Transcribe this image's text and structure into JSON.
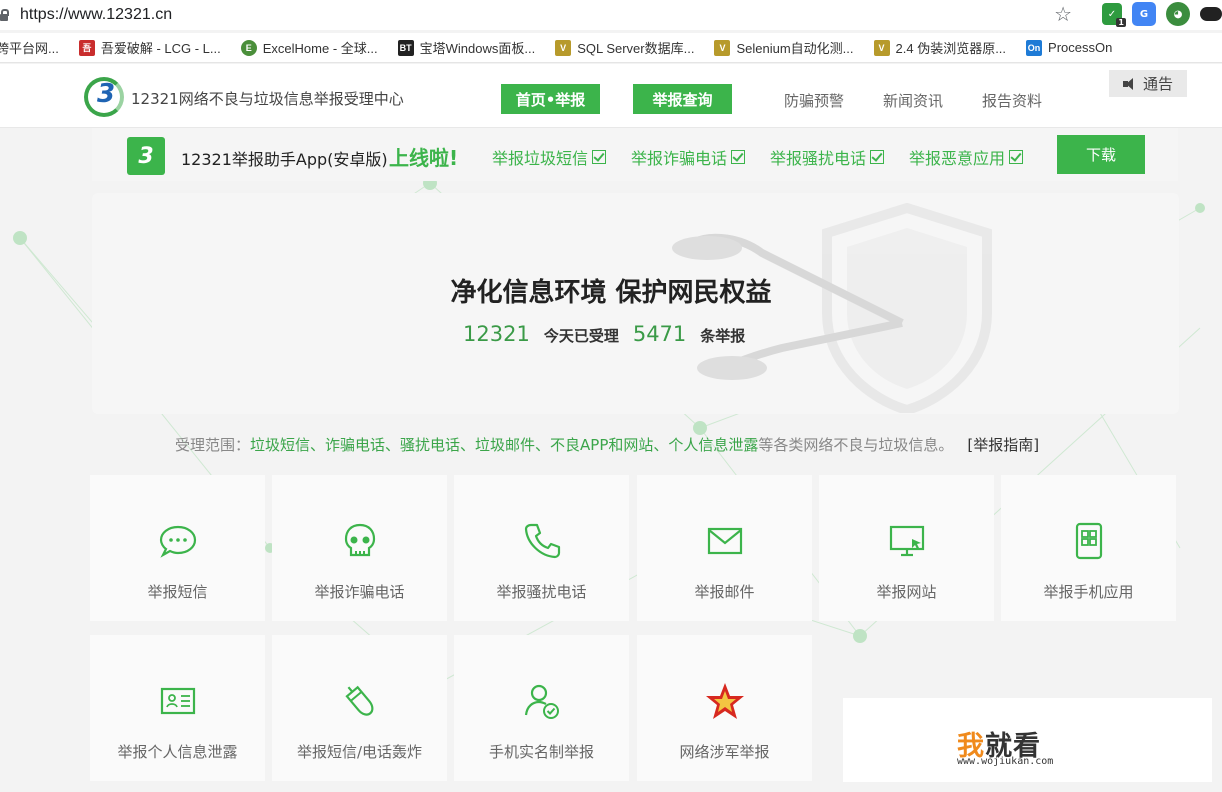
{
  "browser": {
    "url": "https://www.12321.cn",
    "bookmarks": [
      {
        "label": "跨平台网...",
        "icon_color": "#ffffff"
      },
      {
        "label": "吾爱破解 - LCG - L...",
        "icon_color": "#c92d2d"
      },
      {
        "label": "ExcelHome - 全球...",
        "icon_color": "#4b8f3b"
      },
      {
        "label": "宝塔Windows面板...",
        "icon_color": "#222222"
      },
      {
        "label": "SQL Server数据库...",
        "icon_color": "#b79a2b"
      },
      {
        "label": "Selenium自动化测...",
        "icon_color": "#b79a2b"
      },
      {
        "label": "2.4 伪装浏览器原...",
        "icon_color": "#b79a2b"
      },
      {
        "label": "ProcessOn",
        "icon_color": "#1e7bd6"
      }
    ],
    "ext_badge": "1",
    "bm_bt": "BT",
    "bm_on": "On"
  },
  "header": {
    "site_title": "12321网络不良与垃圾信息举报受理中心",
    "nav_home": "首页•举报",
    "nav_query": "举报查询",
    "nav_links": [
      "防骗预警",
      "新闻资讯",
      "报告资料"
    ],
    "notice": "通告"
  },
  "app_banner": {
    "text": "12321举报助手App(安卓版)",
    "live": "上线啦!",
    "features": [
      "举报垃圾短信",
      "举报诈骗电话",
      "举报骚扰电话",
      "举报恶意应用"
    ],
    "download": "下载"
  },
  "hero": {
    "title": "净化信息环境 保护网民权益",
    "brand_num": "12321",
    "today_label": "今天已受理",
    "count": "5471",
    "count_unit": "条举报"
  },
  "scope": {
    "prefix": "受理范围：",
    "items": "垃圾短信、诈骗电话、骚扰电话、垃圾邮件、不良APP和网站、个人信息泄露",
    "suffix": "等各类网络不良与垃圾信息。",
    "guide": "[举报指南]"
  },
  "tiles": [
    {
      "label": "举报短信",
      "icon": "sms-icon"
    },
    {
      "label": "举报诈骗电话",
      "icon": "skull-icon"
    },
    {
      "label": "举报骚扰电话",
      "icon": "phone-icon"
    },
    {
      "label": "举报邮件",
      "icon": "mail-icon"
    },
    {
      "label": "举报网站",
      "icon": "monitor-icon"
    },
    {
      "label": "举报手机应用",
      "icon": "app-icon"
    },
    {
      "label": "举报个人信息泄露",
      "icon": "id-card-icon"
    },
    {
      "label": "举报短信/电话轰炸",
      "icon": "bomb-icon"
    },
    {
      "label": "手机实名制举报",
      "icon": "user-check-icon"
    },
    {
      "label": "网络涉军举报",
      "icon": "army-star-icon"
    }
  ],
  "watermark": {
    "main_a": "我",
    "main_b": "就看",
    "sub": "www.wojiukan.com"
  },
  "colors": {
    "brand_green": "#3cb44b",
    "text_gray": "#666666"
  }
}
